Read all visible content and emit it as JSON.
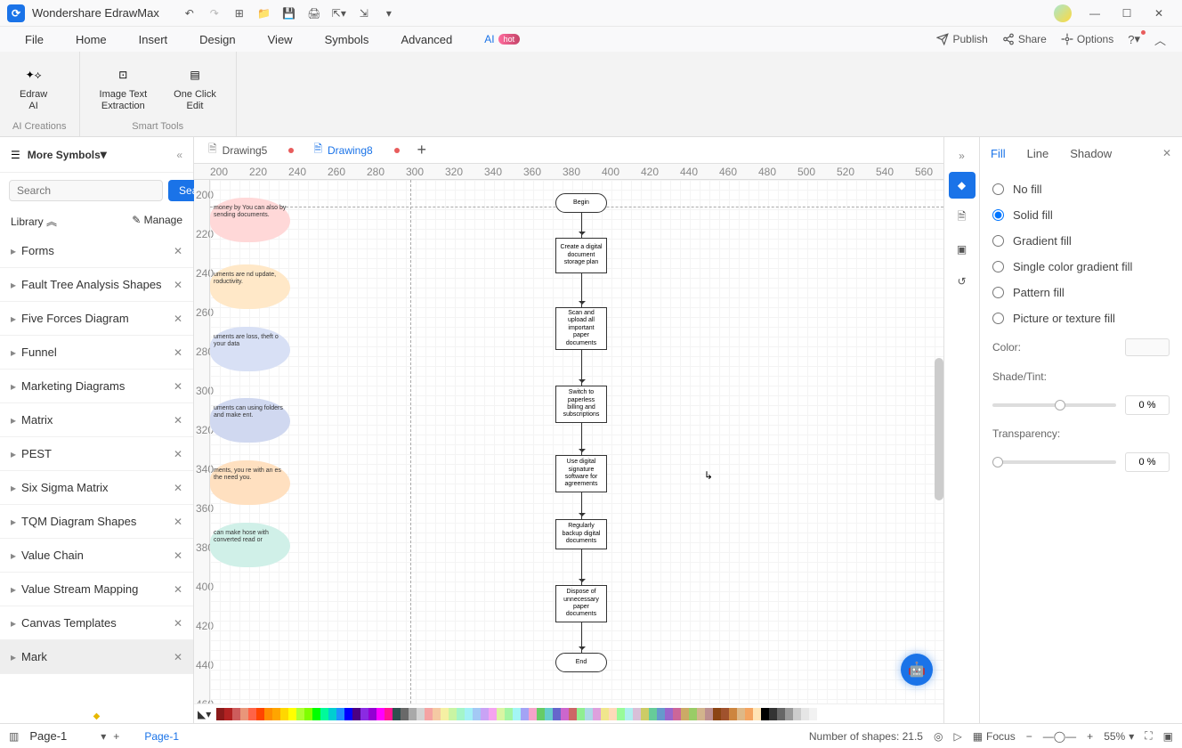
{
  "app": {
    "title": "Wondershare EdrawMax"
  },
  "menubar": {
    "items": [
      "File",
      "Home",
      "Insert",
      "Design",
      "View",
      "Symbols",
      "Advanced",
      "AI"
    ],
    "hot": "hot",
    "publish": "Publish",
    "share": "Share",
    "options": "Options"
  },
  "ribbon": {
    "edraw_ai": "Edraw\nAI",
    "image_text": "Image Text\nExtraction",
    "one_click": "One Click\nEdit",
    "group1": "AI Creations",
    "group2": "Smart Tools"
  },
  "sidebar": {
    "title": "More Symbols",
    "search_placeholder": "Search",
    "search_btn": "Search",
    "library": "Library",
    "manage": "Manage",
    "items": [
      "Forms",
      "Fault Tree Analysis Shapes",
      "Five Forces Diagram",
      "Funnel",
      "Marketing Diagrams",
      "Matrix",
      "PEST",
      "Six Sigma Matrix",
      "TQM Diagram Shapes",
      "Value Chain",
      "Value Stream Mapping",
      "Canvas Templates",
      "Mark"
    ]
  },
  "doc_tabs": {
    "t1": "Drawing5",
    "t2": "Drawing8"
  },
  "ruler_h": [
    "200",
    "220",
    "240",
    "260",
    "280",
    "300",
    "320",
    "340",
    "360",
    "380",
    "400",
    "420",
    "440",
    "460",
    "480",
    "500",
    "520",
    "540",
    "560"
  ],
  "ruler_v": [
    "200",
    "220",
    "240",
    "260",
    "280",
    "300",
    "320",
    "340",
    "360",
    "380",
    "400",
    "420",
    "440",
    "460"
  ],
  "flow": {
    "begin": "Begin",
    "s1": "Create a digital document storage plan",
    "s2": "Scan and upload all important paper documents",
    "s3": "Switch to paperless billing and subscriptions",
    "s4": "Use digital signature software for agreements",
    "s5": "Regularly backup digital documents",
    "s6": "Dispose of unnecessary paper documents",
    "end": "End"
  },
  "blobs": {
    "b1": "money by You can also by sending documents.",
    "b2": "uments are nd update, roductivity.",
    "b3": "uments are loss, theft o your data",
    "b4": "uments can using folders and make ent.",
    "b5": "ments, you re with an es the need you.",
    "b6": "can make hose with converted read or"
  },
  "panel": {
    "tabs": {
      "fill": "Fill",
      "line": "Line",
      "shadow": "Shadow"
    },
    "no_fill": "No fill",
    "solid": "Solid fill",
    "gradient": "Gradient fill",
    "single": "Single color gradient fill",
    "pattern": "Pattern fill",
    "picture": "Picture or texture fill",
    "color": "Color:",
    "shade": "Shade/Tint:",
    "transparency": "Transparency:",
    "pct": "0 %"
  },
  "status": {
    "page_sel": "Page-1",
    "page_tab": "Page-1",
    "shapes": "Number of shapes: 21.5",
    "focus": "Focus",
    "zoom": "55%"
  },
  "palette": [
    "#8b1a1a",
    "#b22222",
    "#cd5c5c",
    "#e9967a",
    "#ff6347",
    "#ff4500",
    "#ff8c00",
    "#ffa500",
    "#ffd700",
    "#ffff00",
    "#adff2f",
    "#7fff00",
    "#00ff00",
    "#00fa9a",
    "#00ced1",
    "#1e90ff",
    "#0000ff",
    "#4b0082",
    "#8a2be2",
    "#9400d3",
    "#ff00ff",
    "#ff1493",
    "#2f4f4f",
    "#696969",
    "#a9a9a9",
    "#d3d3d3",
    "#f5a3a3",
    "#f5c9a3",
    "#f5f0a3",
    "#c9f5a3",
    "#a3f5c9",
    "#a3f0f5",
    "#a3c9f5",
    "#c9a3f5",
    "#f5a3f0",
    "#d9f5a3",
    "#a3f5a3",
    "#a3f5f5",
    "#a3a3f5",
    "#f5a3c9",
    "#66cc66",
    "#66cccc",
    "#6666cc",
    "#cc66cc",
    "#cc6666",
    "#90ee90",
    "#add8e6",
    "#dda0dd",
    "#f0e68c",
    "#ffdab9",
    "#98fb98",
    "#afeeee",
    "#d8bfd8",
    "#cccc66",
    "#66cc99",
    "#6699cc",
    "#9966cc",
    "#cc6699",
    "#ccaa66",
    "#99cc66",
    "#d2b48c",
    "#bc8f8f",
    "#8b4513",
    "#a0522d",
    "#cd853f",
    "#deb887",
    "#f4a460",
    "#ffe4b5",
    "#000000",
    "#333333",
    "#666666",
    "#999999",
    "#cccccc",
    "#e6e6e6",
    "#f2f2f2",
    "#ffffff"
  ]
}
